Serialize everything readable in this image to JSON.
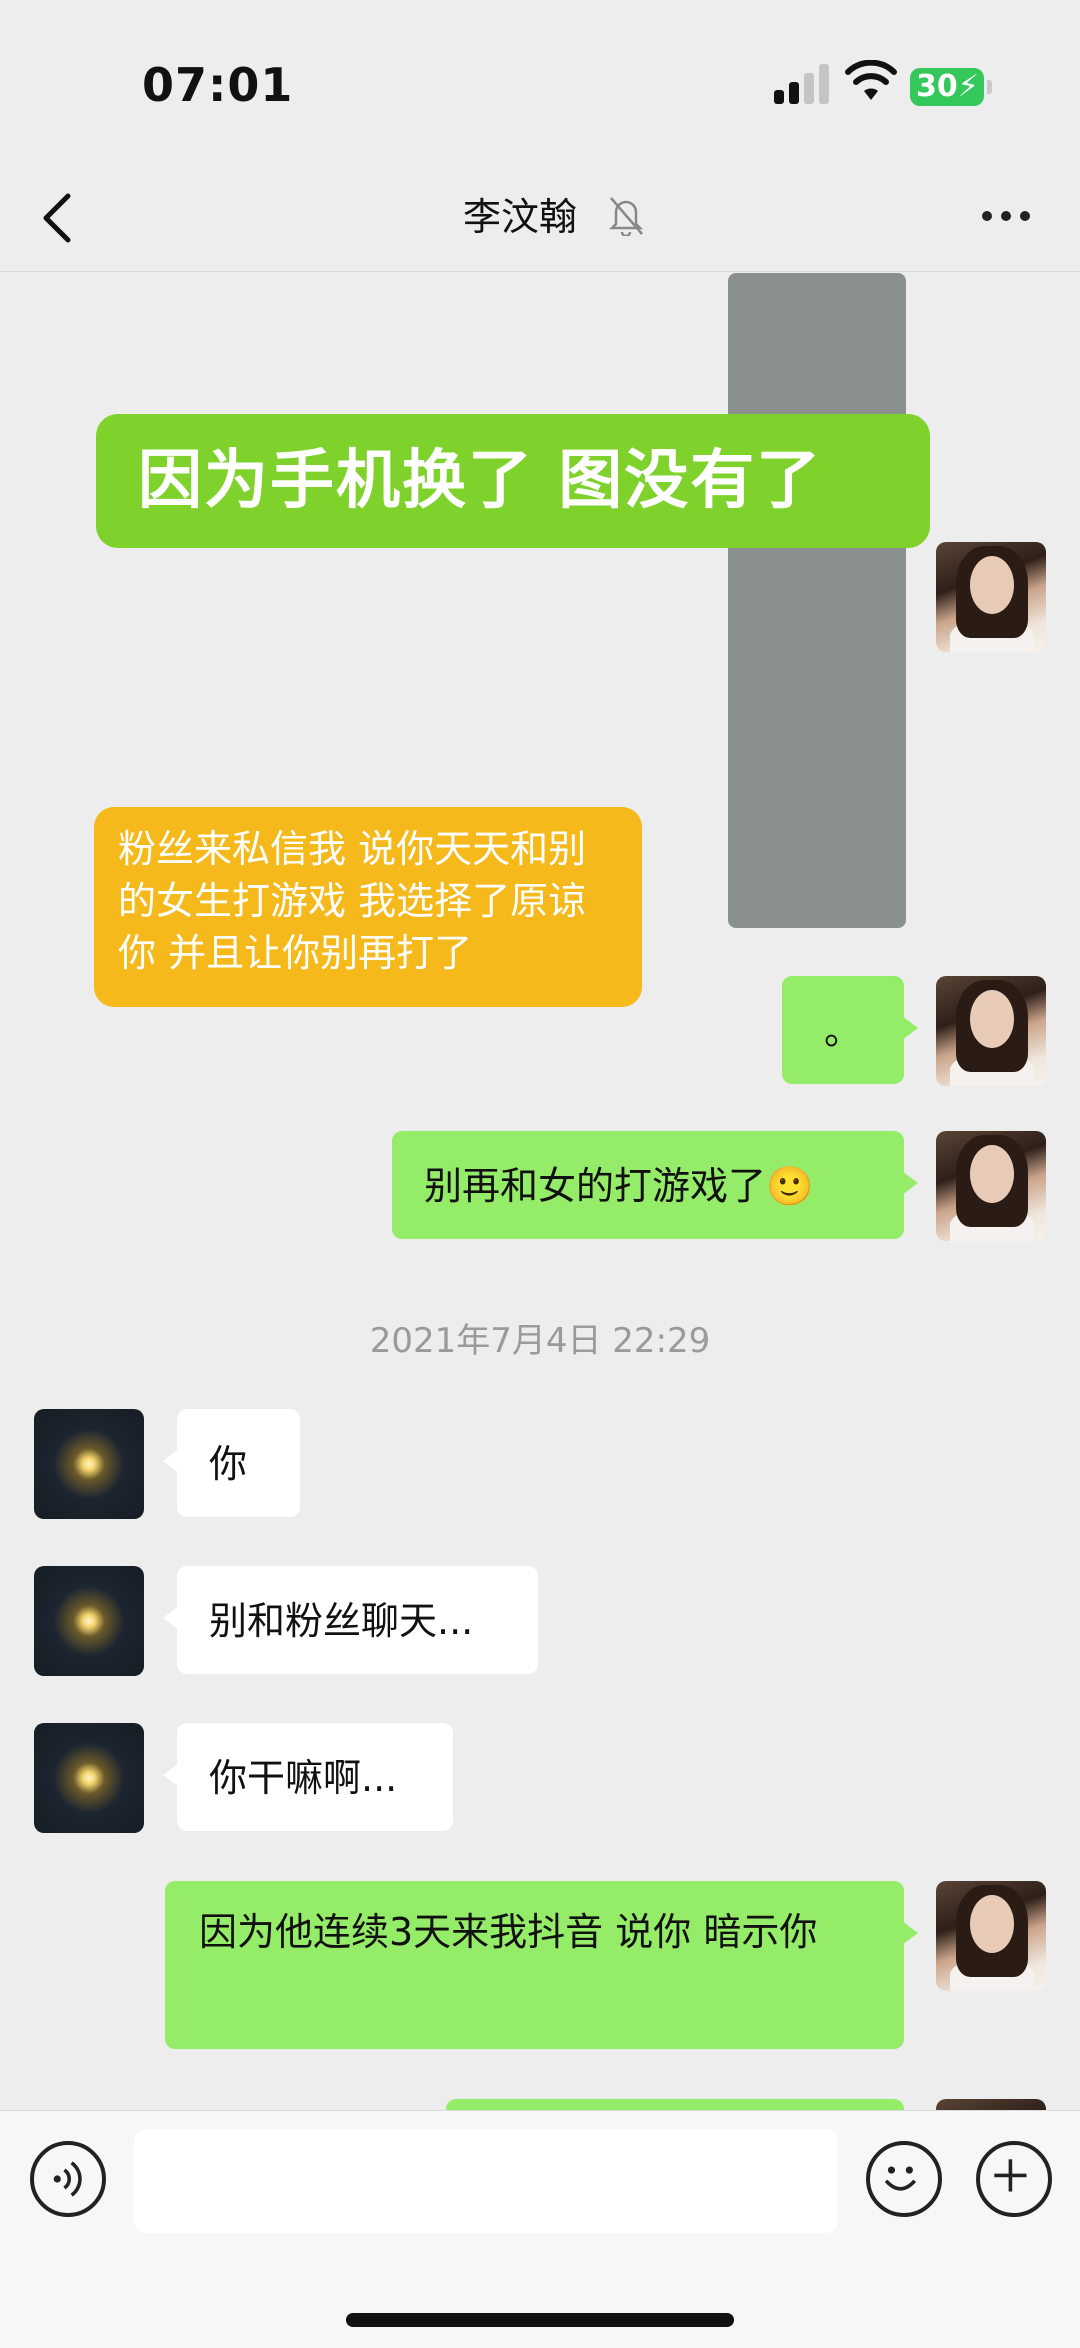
{
  "status_bar": {
    "time": "07:01",
    "battery": "30"
  },
  "header": {
    "title": "李汶翰"
  },
  "overlays": {
    "headline": "因为手机换了 图没有了",
    "note": "粉丝来私信我 说你天天和别的女生打游戏 我选择了原谅你 并且让你别再打了"
  },
  "messages": {
    "m1": "。",
    "m2": "别再和女的打游戏了🙂",
    "timestamp": "2021年7月4日 22:29",
    "m3": "你",
    "m4": "别和粉丝聊天...",
    "m5": "你干嘛啊...",
    "m6": "因为他连续3天来我抖音 说你 暗示你"
  },
  "input_bar": {
    "placeholder": ""
  },
  "colors": {
    "self_bubble": "#95ec69",
    "other_bubble": "#ffffff",
    "background": "#ededed",
    "headline_overlay": "#7fd12b",
    "note_overlay": "#f6b91b"
  },
  "icons": [
    "back-icon",
    "mute-bell-icon",
    "more-icon",
    "voice-icon",
    "emoji-icon",
    "plus-icon"
  ]
}
